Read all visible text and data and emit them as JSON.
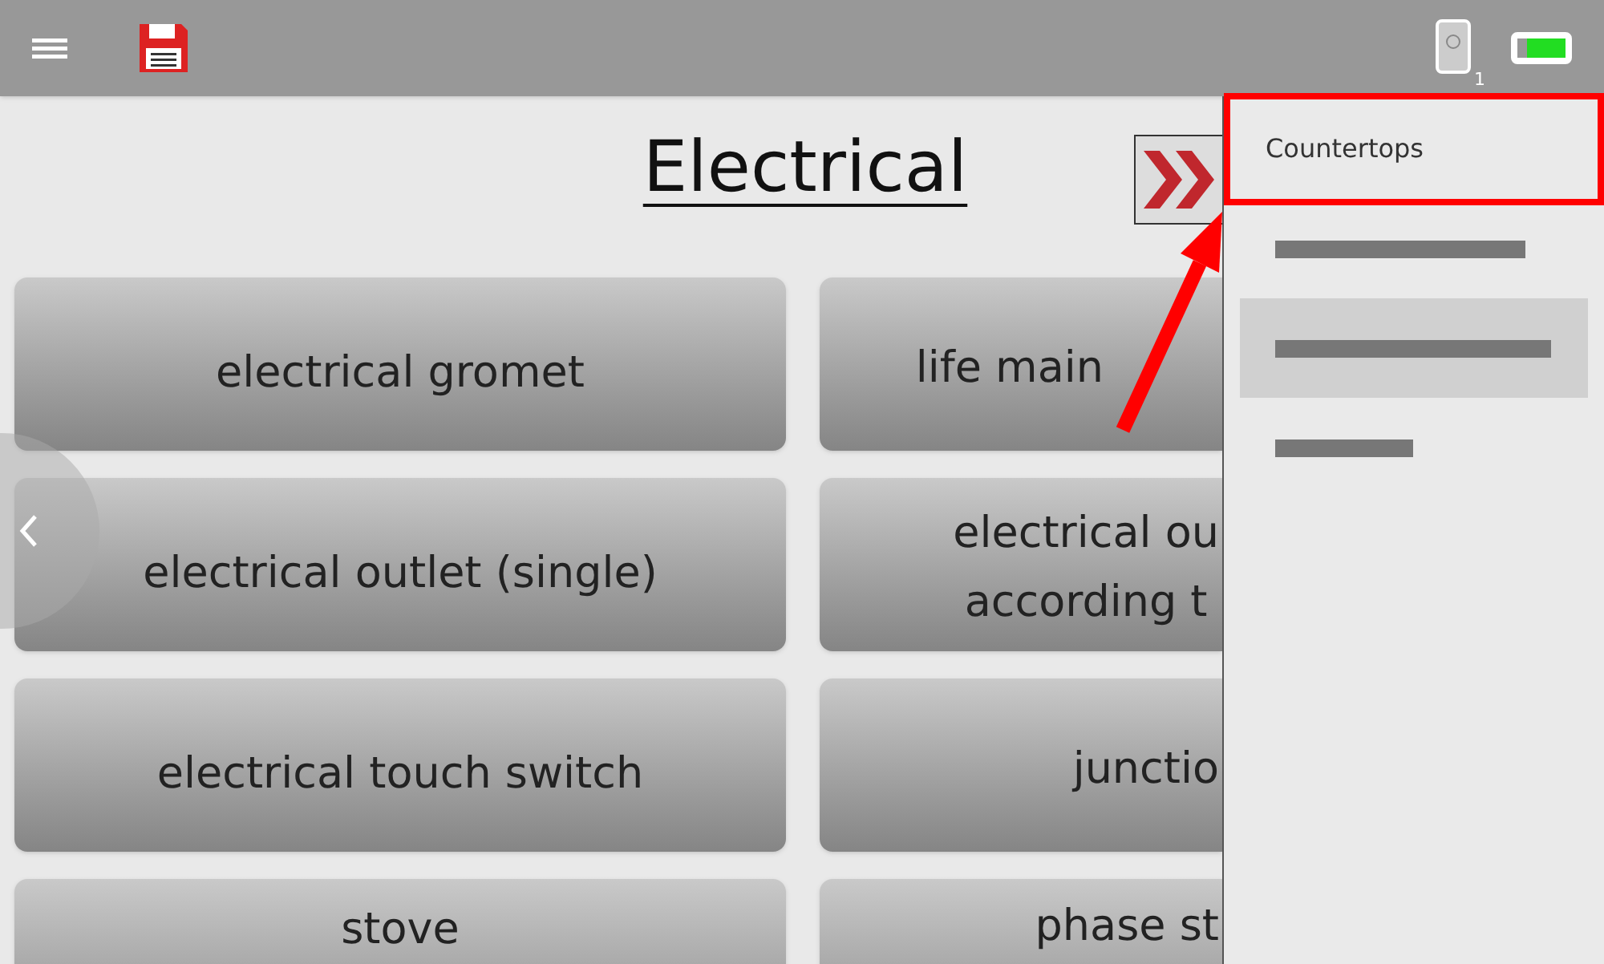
{
  "title": "Electrical",
  "buttons": [
    {
      "lines": [
        "electrical gromet"
      ]
    },
    {
      "lines": [
        "life main"
      ]
    },
    {
      "lines": [
        "electrical outlet (single)"
      ]
    },
    {
      "lines": [
        "electrical ou",
        "according t"
      ]
    },
    {
      "lines": [
        "electrical touch switch"
      ]
    },
    {
      "lines": [
        "junctio"
      ]
    },
    {
      "lines": [
        "stove"
      ]
    },
    {
      "lines": [
        "phase st"
      ]
    }
  ],
  "menu": [
    {
      "kind": "text",
      "label": "Countertops",
      "selected": false,
      "highlighted": true
    },
    {
      "kind": "redacted",
      "selected": false,
      "highlighted": false
    },
    {
      "kind": "redacted",
      "selected": true,
      "highlighted": false
    },
    {
      "kind": "redacted",
      "selected": false,
      "highlighted": false
    }
  ],
  "device_count": "1"
}
